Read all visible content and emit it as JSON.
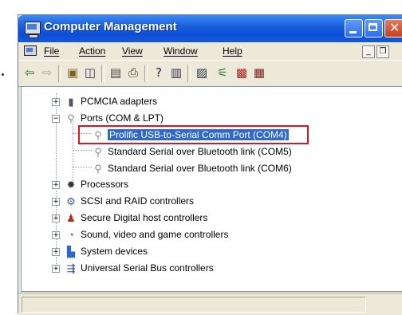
{
  "window": {
    "title": "Computer Management"
  },
  "menu": {
    "file": "File",
    "action": "Action",
    "view": "View",
    "window": "Window",
    "help": "Help"
  },
  "toolbar": {
    "icons": [
      "back-arrow-icon",
      "forward-arrow-icon",
      "up-folder-icon",
      "show-hide-tree-icon",
      "properties-icon",
      "print-icon",
      "help-icon",
      "console-icon",
      "scan-hardware-icon",
      "update-driver-icon",
      "uninstall-icon",
      "disable-icon"
    ]
  },
  "tree": {
    "items": [
      {
        "label": "PCMCIA adapters"
      },
      {
        "label": "Ports (COM & LPT)"
      },
      {
        "label": "Prolific USB-to-Serial Comm Port (COM4)"
      },
      {
        "label": "Standard Serial over Bluetooth link (COM5)"
      },
      {
        "label": "Standard Serial over Bluetooth link (COM6)"
      },
      {
        "label": "Processors"
      },
      {
        "label": "SCSI and RAID controllers"
      },
      {
        "label": "Secure Digital host controllers"
      },
      {
        "label": "Sound, video and game controllers"
      },
      {
        "label": "System devices"
      },
      {
        "label": "Universal Serial Bus controllers"
      }
    ]
  },
  "colors": {
    "titlebar": "#0b4fd8",
    "selection": "#316ac5",
    "highlight_box": "#e0141e"
  }
}
